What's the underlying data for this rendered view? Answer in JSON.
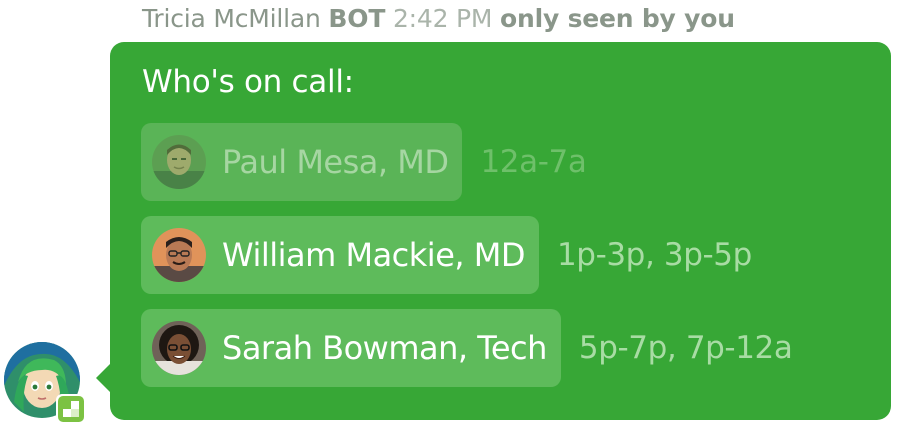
{
  "message": {
    "sender": "Tricia McMillan",
    "bot_label": "BOT",
    "time": "2:42 PM",
    "visibility": "only seen by you"
  },
  "card": {
    "title": "Who's on call:",
    "rows": [
      {
        "name": "Paul Mesa, MD",
        "shift": "12a-7a",
        "state": "past"
      },
      {
        "name": "William Mackie, MD",
        "shift": "1p-3p, 3p-5p",
        "state": "current"
      },
      {
        "name": "Sarah Bowman, Tech",
        "shift": "5p-7p, 7p-12a",
        "state": "upcoming"
      }
    ]
  },
  "colors": {
    "bubble": "#37a736",
    "chip": "#5ebb5b",
    "badge": "#7cc243"
  },
  "icons": {
    "bot_avatar": "green-haired-character-avatar",
    "bot_badge": "app-badge-icon"
  }
}
